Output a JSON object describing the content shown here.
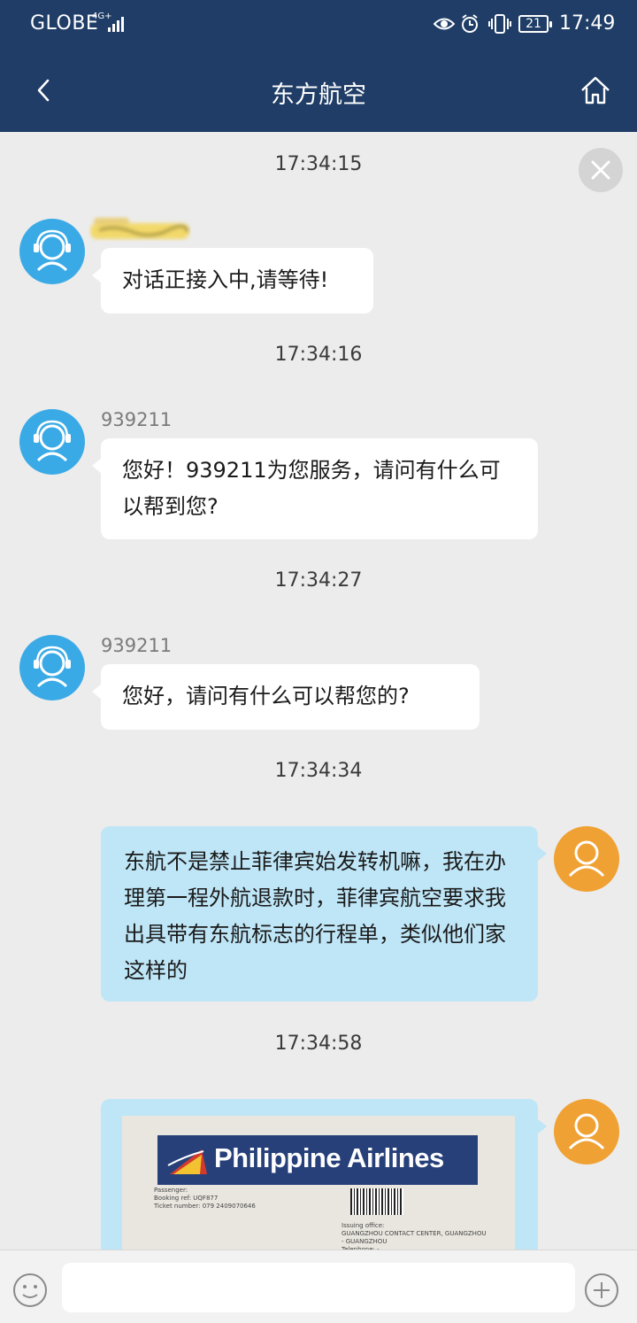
{
  "status_bar": {
    "carrier": "GLOBE",
    "network": "4G+",
    "battery": "21",
    "time": "17:49"
  },
  "header": {
    "title": "东方航空"
  },
  "messages": [
    {
      "timestamp": "17:34:15",
      "sender": "",
      "text": "对话正接入中,请等待!"
    },
    {
      "timestamp": "17:34:16",
      "sender": "939211",
      "text": "您好！939211为您服务，请问有什么可以帮到您?"
    },
    {
      "timestamp": "17:34:27",
      "sender": "939211",
      "text": "您好，请问有什么可以帮您的?"
    },
    {
      "timestamp": "17:34:34",
      "text": "东航不是禁止菲律宾始发转机嘛，我在办理第一程外航退款时，菲律宾航空要求我出具带有东航标志的行程单，类似他们家这样的"
    },
    {
      "timestamp": "17:34:58"
    }
  ],
  "photo": {
    "brand": "Philippine Airlines",
    "lines": [
      "Passenger:",
      "Booking ref: UQF877",
      "Ticket number: 079 2409070646"
    ],
    "issuing": [
      "Issuing office:",
      "GUANGZHOU CONTACT CENTER, GUANGZHOU",
      "- GUANGZHOU",
      "Telephone: -"
    ]
  },
  "input": {
    "placeholder": ""
  },
  "colors": {
    "header_bg": "#1f3d66",
    "agent_avatar": "#3aaae6",
    "user_avatar": "#f0a133",
    "outgoing_bubble": "#bfe6f7"
  }
}
